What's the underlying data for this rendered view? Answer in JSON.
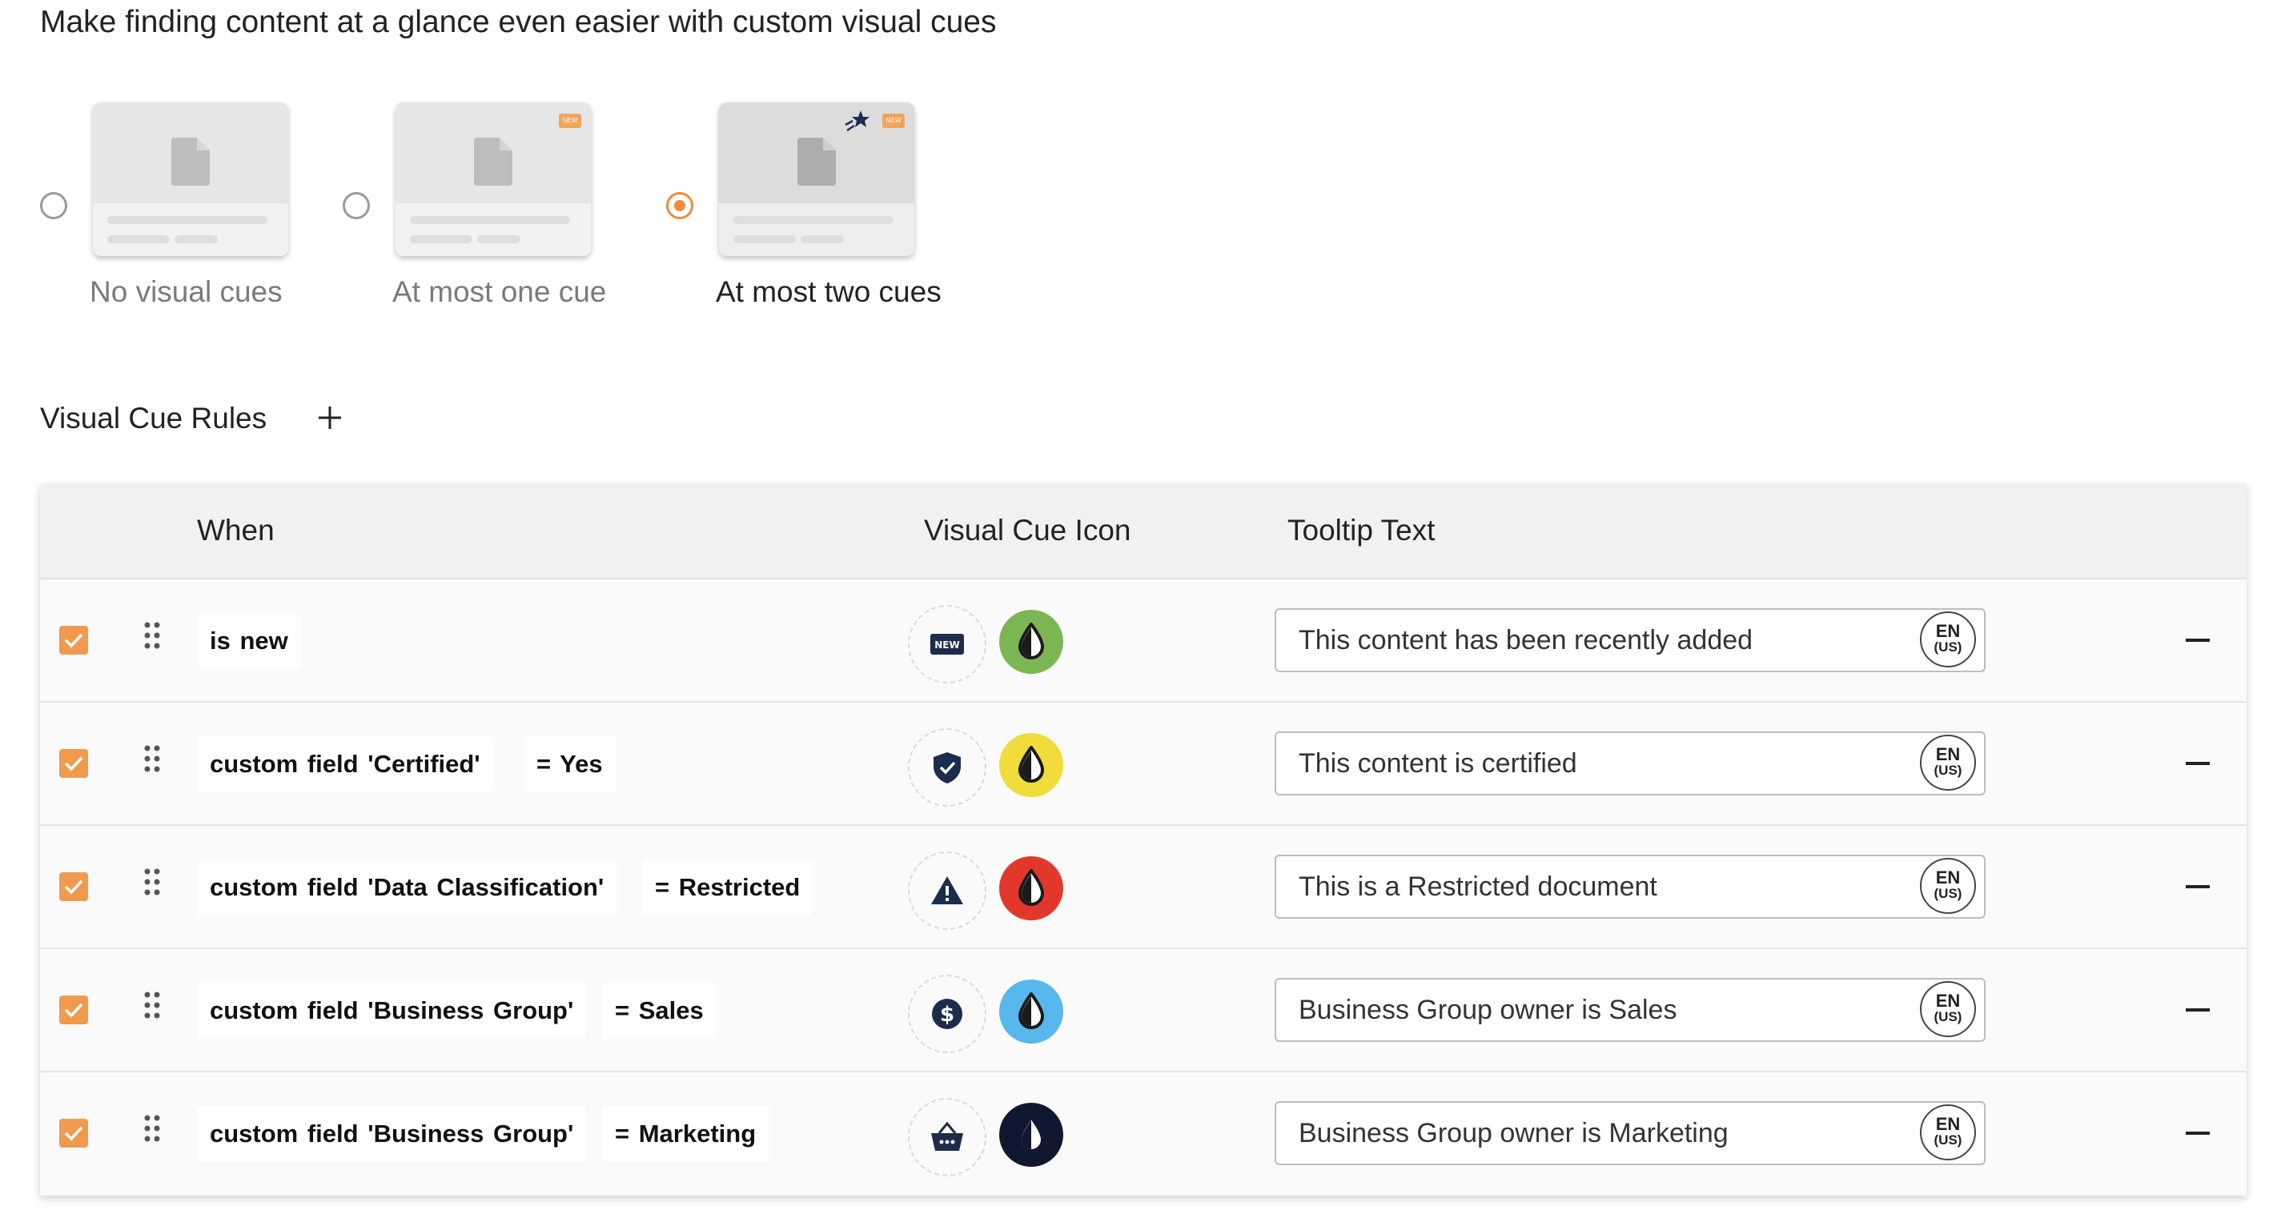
{
  "heading": "Make finding content at a glance even easier with custom visual cues",
  "options": [
    {
      "label": "No visual cues",
      "selected": false
    },
    {
      "label": "At most one cue",
      "selected": false,
      "badge": "NEW"
    },
    {
      "label": "At most two cues",
      "selected": true,
      "badge": "NEW"
    }
  ],
  "rules_title": "Visual Cue Rules",
  "add_icon": "plus-icon",
  "table": {
    "headers": {
      "when": "When",
      "icon": "Visual Cue Icon",
      "tooltip": "Tooltip Text"
    },
    "rows": [
      {
        "checked": true,
        "condition": "is new",
        "value": "",
        "icon": "new-badge-icon",
        "color": "#7cb652",
        "tooltip": "This content has been recently added",
        "lang1": "EN",
        "lang2": "(US)"
      },
      {
        "checked": true,
        "condition": "custom field  'Certified'",
        "value": "= Yes",
        "icon": "shield-check-icon",
        "color": "#f0dc3a",
        "tooltip": "This content is certified",
        "lang1": "EN",
        "lang2": "(US)"
      },
      {
        "checked": true,
        "condition": "custom field  'Data Classification'",
        "value": "= Restricted",
        "icon": "warning-icon",
        "color": "#e2382c",
        "tooltip": "This is a Restricted document",
        "lang1": "EN",
        "lang2": "(US)"
      },
      {
        "checked": true,
        "condition": "custom field  'Business Group'",
        "value": "= Sales",
        "icon": "dollar-icon",
        "color": "#58b7ec",
        "tooltip": "Business Group owner is Sales",
        "lang1": "EN",
        "lang2": "(US)"
      },
      {
        "checked": true,
        "condition": "custom field  'Business Group'",
        "value": "= Marketing",
        "icon": "basket-icon",
        "color": "#0f1830",
        "tooltip": "Business Group owner is Marketing",
        "lang1": "EN",
        "lang2": "(US)"
      }
    ]
  }
}
